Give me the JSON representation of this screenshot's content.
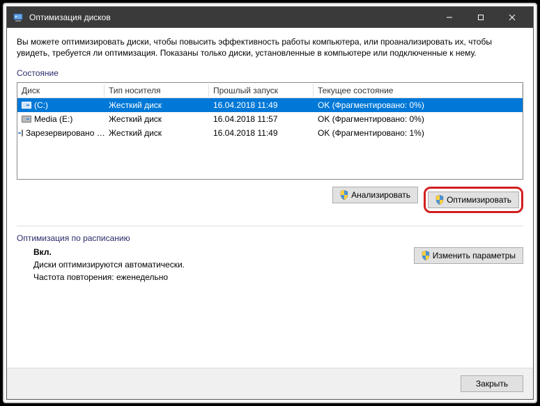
{
  "window": {
    "title": "Оптимизация дисков"
  },
  "description": "Вы можете оптимизировать диски, чтобы повысить эффективность работы  компьютера, или проанализировать их, чтобы увидеть, требуется ли оптимизация. Показаны только диски, установленные в компьютере или подключенные к нему.",
  "status_label": "Состояние",
  "table": {
    "headers": {
      "disk": "Диск",
      "media": "Тип носителя",
      "last": "Прошлый запуск",
      "status": "Текущее состояние"
    },
    "rows": [
      {
        "disk": "(C:)",
        "media": "Жесткий диск",
        "last": "16.04.2018 11:49",
        "status": "OK (Фрагментировано: 0%)",
        "selected": true
      },
      {
        "disk": "Media (E:)",
        "media": "Жесткий диск",
        "last": "16.04.2018 11:57",
        "status": "OK (Фрагментировано: 0%)",
        "selected": false
      },
      {
        "disk": "Зарезервировано …",
        "media": "Жесткий диск",
        "last": "16.04.2018 11:49",
        "status": "OK (Фрагментировано: 1%)",
        "selected": false
      }
    ]
  },
  "buttons": {
    "analyze": "Анализировать",
    "optimize": "Оптимизировать",
    "change_settings": "Изменить параметры",
    "close": "Закрыть"
  },
  "schedule": {
    "label": "Оптимизация по расписанию",
    "status": "Вкл.",
    "line1": "Диски оптимизируются автоматически.",
    "line2": "Частота повторения: еженедельно"
  }
}
